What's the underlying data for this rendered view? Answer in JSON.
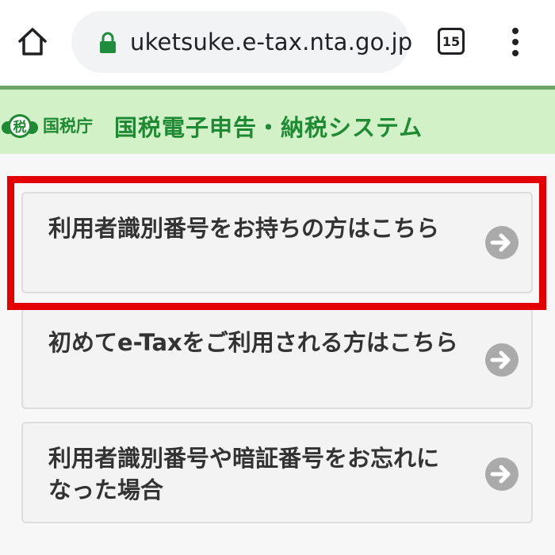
{
  "browser": {
    "url": "uketsuke.e-tax.nta.go.jp",
    "tab_count": "15",
    "icons": [
      "home-icon",
      "lock-icon",
      "tab-switcher-icon",
      "more-menu-icon"
    ]
  },
  "header": {
    "logo_text": "税",
    "agency": "国税庁",
    "title": "国税電子申告・納税システム",
    "background_color": "#d3f1c7",
    "text_color": "#1e8a33"
  },
  "options": [
    {
      "label": "利用者識別番号をお持ちの方はこちら",
      "highlighted": true
    },
    {
      "label": "初めてe-Taxをご利用される方はこちら",
      "highlighted": false
    },
    {
      "label": "利用者識別番号や暗証番号をお忘れになった場合",
      "highlighted": false
    }
  ],
  "highlight_color": "#e40000"
}
